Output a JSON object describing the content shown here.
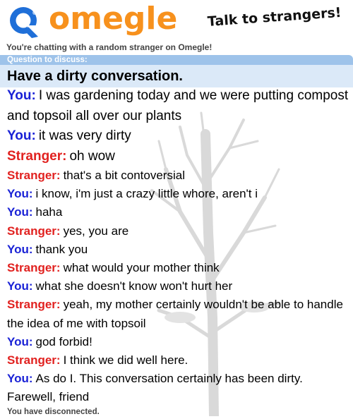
{
  "header": {
    "logo_text": "omegle",
    "tagline": "Talk to strangers!"
  },
  "subtitle": "You're chatting with a random stranger on Omegle!",
  "question": {
    "label": "Question to discuss:",
    "text": "Have a dirty conversation."
  },
  "colors": {
    "you": "#1a22d6",
    "stranger": "#e1211f",
    "logo_orange": "#f7911d",
    "logo_blue": "#1f6fd8",
    "question_bar": "#9ec3ea",
    "question_box": "#dbe9f8"
  },
  "messages": [
    {
      "sender": "You:",
      "text": "I was gardening today and we were putting compost and topsoil all over our plants"
    },
    {
      "sender": "You:",
      "text": "it was very dirty"
    },
    {
      "sender": "Stranger:",
      "text": "oh wow"
    },
    {
      "sender": "Stranger:",
      "text": "that's a bit contoversial"
    },
    {
      "sender": "You:",
      "text": "i know, i'm just a crazy little whore, aren't i"
    },
    {
      "sender": "You:",
      "text": "haha"
    },
    {
      "sender": "Stranger:",
      "text": "yes, you are"
    },
    {
      "sender": "You:",
      "text": "thank you"
    },
    {
      "sender": "Stranger:",
      "text": "what would your mother think"
    },
    {
      "sender": "You:",
      "text": "what she doesn't know won't hurt her"
    },
    {
      "sender": "Stranger:",
      "text": "yeah, my mother certainly wouldn't be able to handle the idea of me with topsoil"
    },
    {
      "sender": "You:",
      "text": "god forbid!"
    },
    {
      "sender": "Stranger:",
      "text": "I think we did well here."
    },
    {
      "sender": "You:",
      "text": "As do I. This conversation certainly has been dirty. Farewell, friend"
    }
  ],
  "footer": "You have disconnected."
}
